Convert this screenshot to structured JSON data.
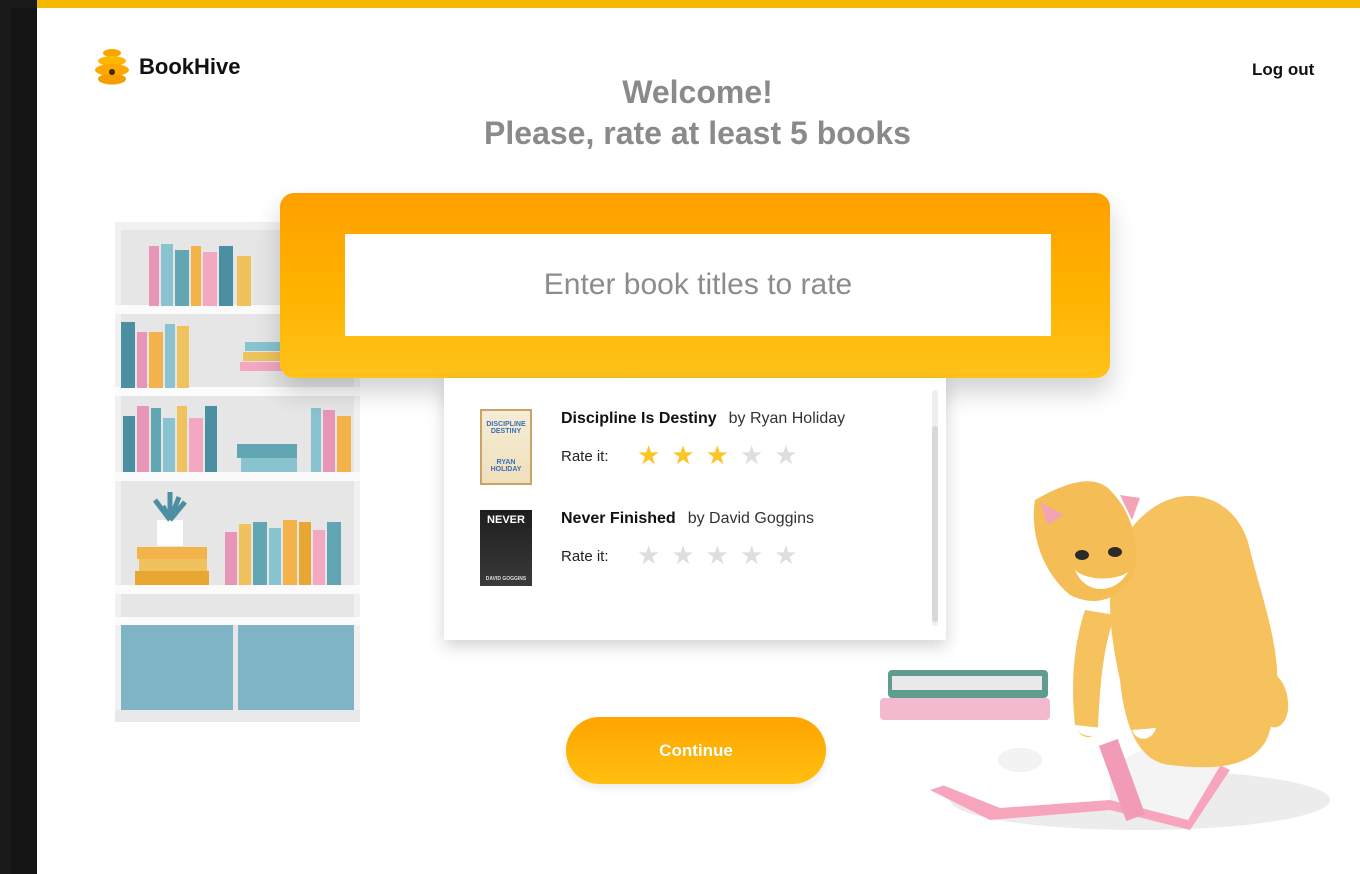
{
  "brand": {
    "name": "BookHive",
    "icon": "beehive-icon"
  },
  "header": {
    "logout_label": "Log out"
  },
  "welcome": {
    "line1": "Welcome!",
    "line2": "Please, rate at least 5 books"
  },
  "search": {
    "placeholder": "Enter book titles to rate",
    "value": ""
  },
  "results": [
    {
      "title": "Discipline Is Destiny",
      "author": "by Ryan Holiday",
      "rate_label": "Rate it:",
      "rating": 3,
      "max": 5,
      "cover": "book-cover-image"
    },
    {
      "title": "Never Finished",
      "author": "by David Goggins",
      "rate_label": "Rate it:",
      "rating": 0,
      "max": 5,
      "cover": "book-cover-image"
    }
  ],
  "continue_label": "Continue",
  "colors": {
    "accent": "#ffb000",
    "star_on": "#fdc425",
    "star_off": "#dedede",
    "heading": "#8a8a8a"
  }
}
